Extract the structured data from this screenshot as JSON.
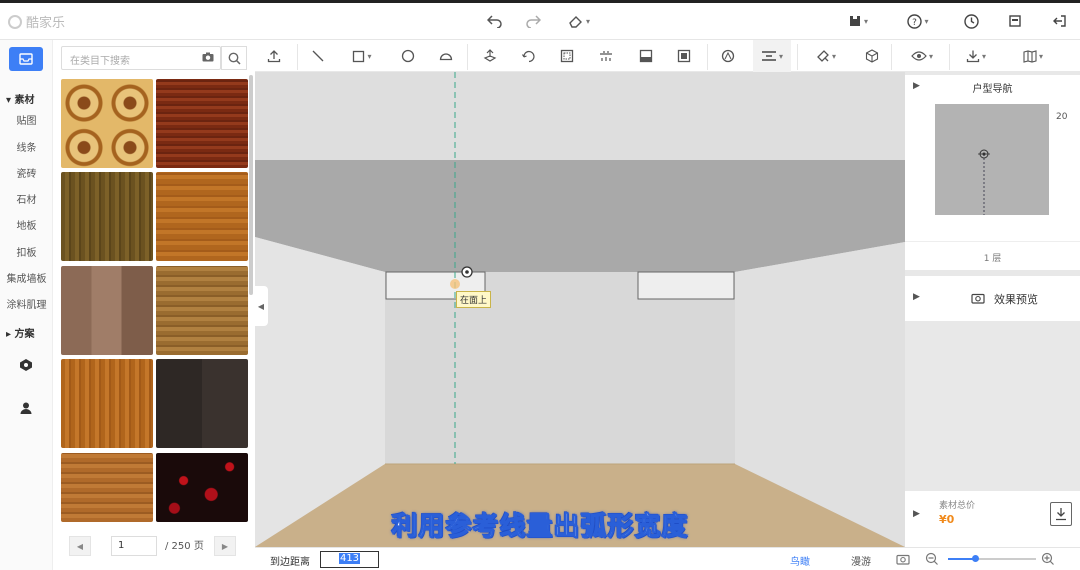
{
  "app": {
    "logo": "酷家乐"
  },
  "search": {
    "placeholder": "在类目下搜索"
  },
  "leftnav": {
    "section_material": "素材",
    "items": [
      "贴图",
      "线条",
      "瓷砖",
      "石材",
      "地板",
      "扣板",
      "集成墙板",
      "涂料肌理"
    ],
    "section_plan": "方案"
  },
  "pager": {
    "current": "1",
    "total": "/ 250 页"
  },
  "right": {
    "nav_title": "户型导航",
    "map_number": "20",
    "floor": "1 层",
    "preview": "效果预览",
    "total_label": "素材总价",
    "total_value": "¥0"
  },
  "viewport": {
    "tooltip": "在面上"
  },
  "bottom": {
    "distance_label": "到边距离",
    "distance_value": "413",
    "view_bird": "鸟瞰",
    "view_roam": "漫游"
  },
  "subtitle": "利用参考线量出弧形宽度",
  "colors": {
    "accent": "#3d7ff6",
    "price": "#f08a1c"
  },
  "icons": {
    "top": [
      "undo-icon",
      "redo-icon",
      "eraser-icon",
      "save-icon",
      "help-icon",
      "history-icon",
      "archive-icon",
      "exit-icon"
    ],
    "toolbar": [
      "upload-icon",
      "line-icon",
      "rect-icon",
      "circle-icon",
      "arc-icon",
      "move-icon",
      "rotate-icon",
      "frame-icon",
      "light-icon",
      "cabinet-icon",
      "grid-icon",
      "measure-icon",
      "align-icon",
      "paint-icon",
      "cube-icon",
      "view-icon",
      "download-icon",
      "map-icon"
    ]
  }
}
